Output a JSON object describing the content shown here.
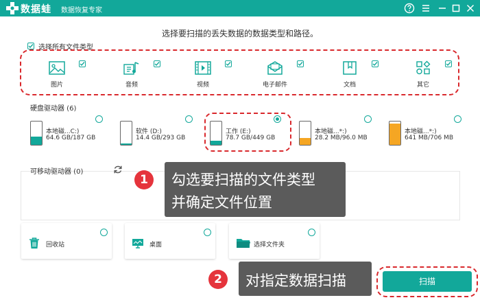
{
  "titlebar": {
    "app_name": "数据蛙",
    "app_subtitle": "数据恢复专家"
  },
  "main": {
    "instruction": "选择要扫描的丢失数据的数据类型和路径。",
    "select_all_label": "选择所有文件类型",
    "file_types": [
      {
        "label": "图片",
        "icon": "image-icon",
        "checked": true
      },
      {
        "label": "音频",
        "icon": "music-icon",
        "checked": true
      },
      {
        "label": "视频",
        "icon": "video-icon",
        "checked": true
      },
      {
        "label": "电子邮件",
        "icon": "email-icon",
        "checked": true
      },
      {
        "label": "文档",
        "icon": "document-icon",
        "checked": true
      },
      {
        "label": "其它",
        "icon": "other-icon",
        "checked": true
      }
    ],
    "hdd_section_title": "硬盘驱动器 (6)",
    "drives": [
      {
        "name": "本地磁...C:)",
        "size": "64.6 GB/187 GB",
        "used_fraction": 0.35,
        "fill_color": "#12a89a",
        "selected": false
      },
      {
        "name": "软件 (D:)",
        "size": "14.4 GB/293 GB",
        "used_fraction": 0.05,
        "fill_color": "#12a89a",
        "selected": false
      },
      {
        "name": "工作 (E:)",
        "size": "78.7 GB/449 GB",
        "used_fraction": 0.18,
        "fill_color": "#12a89a",
        "selected": true
      },
      {
        "name": "本地磁...*:)",
        "size": "28.2 MB/96.0 MB",
        "used_fraction": 0.29,
        "fill_color": "#f5a623",
        "selected": false
      },
      {
        "name": "本地磁...*:)",
        "size": "641 MB/706 MB",
        "used_fraction": 0.91,
        "fill_color": "#f5a623",
        "selected": false
      }
    ],
    "removable_section_title": "可移动驱动器 (0)",
    "locations": [
      {
        "label": "回收站",
        "icon": "recycle-bin-icon"
      },
      {
        "label": "桌面",
        "icon": "desktop-icon"
      },
      {
        "label": "选择文件夹",
        "icon": "folder-icon"
      }
    ],
    "scan_label": "扫描"
  },
  "callouts": {
    "step1_number": "1",
    "step1_line1": "勾选要扫描的文件类型",
    "step1_line2": "并确定文件位置",
    "step2_number": "2",
    "step2_text": "对指定数据扫描"
  },
  "colors": {
    "accent": "#12a89a",
    "annotation_red": "#d9282c",
    "callout_bg": "#5b5b5b"
  }
}
